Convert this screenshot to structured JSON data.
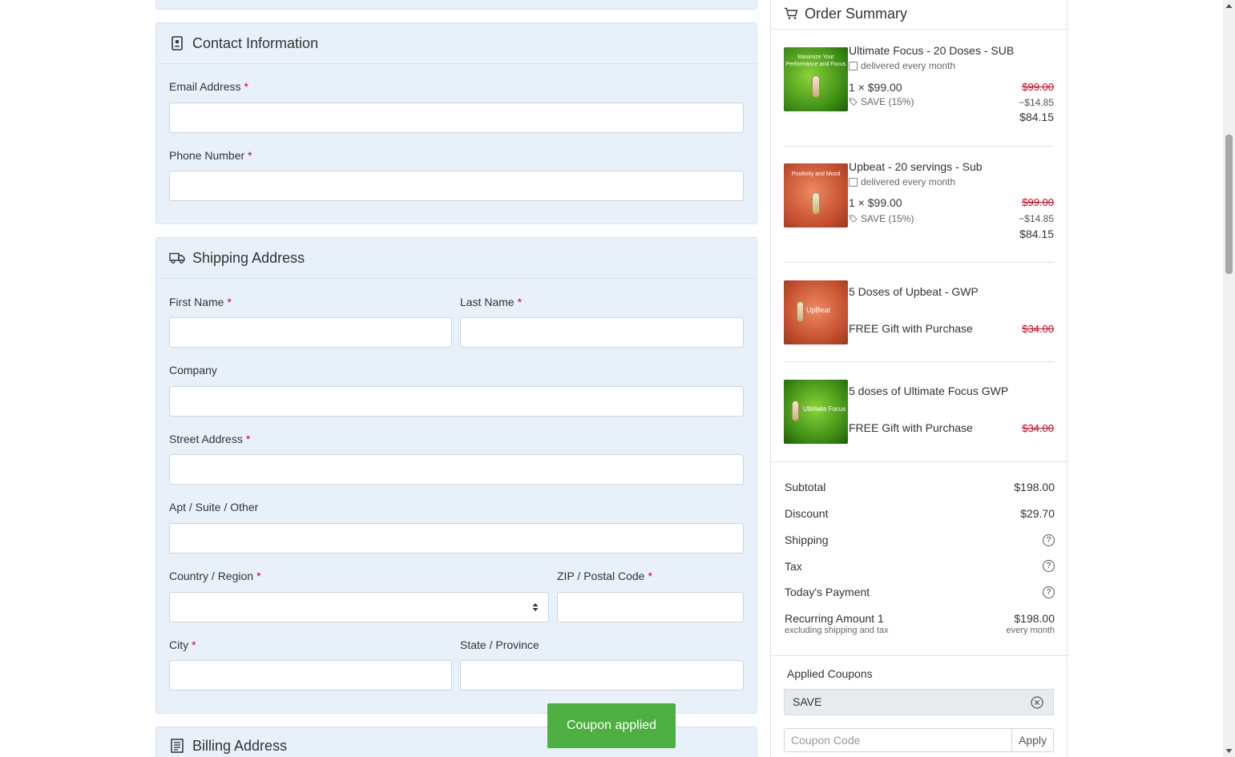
{
  "contact": {
    "title": "Contact Information",
    "email_label": "Email Address",
    "phone_label": "Phone Number",
    "required_mark": "*"
  },
  "shipping": {
    "title": "Shipping Address",
    "first_name_label": "First Name",
    "last_name_label": "Last Name",
    "company_label": "Company",
    "street_label": "Street Address",
    "apt_label": "Apt / Suite / Other",
    "country_label": "Country / Region",
    "zip_label": "ZIP / Postal Code",
    "city_label": "City",
    "state_label": "State / Province",
    "required_mark": "*"
  },
  "billing": {
    "title": "Billing Address"
  },
  "summary": {
    "title": "Order Summary",
    "items": [
      {
        "name": "Ultimate Focus - 20 Doses - SUB",
        "frequency": "delivered every month",
        "qty_price": "1 × $99.00",
        "original": "$99.00",
        "discount_label": "SAVE (15%)",
        "discount": "−$14.85",
        "total": "$84.15",
        "thumb_text": "Maximize Your Performance and Focus",
        "thumb_colors": [
          "#6fbf2a",
          "#2f7a10"
        ]
      },
      {
        "name": "Upbeat - 20 servings - Sub",
        "frequency": "delivered every month",
        "qty_price": "1 × $99.00",
        "original": "$99.00",
        "discount_label": "SAVE (15%)",
        "discount": "−$14.85",
        "total": "$84.15",
        "thumb_text": "Positivity and Mood",
        "thumb_colors": [
          "#e07a55",
          "#b2402a"
        ]
      },
      {
        "name": "5 Doses of Upbeat - GWP",
        "note": "FREE Gift with Purchase",
        "original": "$34.00",
        "thumb_text": "UpBeat",
        "thumb_colors": [
          "#e07a55",
          "#b2402a"
        ]
      },
      {
        "name": "5 doses of Ultimate Focus GWP",
        "note": "FREE Gift with Purchase",
        "original": "$34.00",
        "thumb_text": "Ultimate Focus",
        "thumb_colors": [
          "#6fbf2a",
          "#2f7a10"
        ]
      }
    ],
    "subtotal_label": "Subtotal",
    "subtotal": "$198.00",
    "discount_label": "Discount",
    "discount": "$29.70",
    "shipping_label": "Shipping",
    "tax_label": "Tax",
    "today_label": "Today's Payment",
    "recurring_label": "Recurring Amount 1",
    "recurring_sub": "excluding shipping and tax",
    "recurring_value": "$198.00",
    "recurring_freq": "every month",
    "help_glyph": "?"
  },
  "coupons": {
    "title": "Applied Coupons",
    "applied_code": "SAVE",
    "input_placeholder": "Coupon Code",
    "apply_label": "Apply"
  },
  "toast": {
    "message": "Coupon applied"
  },
  "colors": {
    "accent_success": "#4caf3f",
    "required": "#d0021b",
    "panel_bg": "#e8f1fa"
  }
}
